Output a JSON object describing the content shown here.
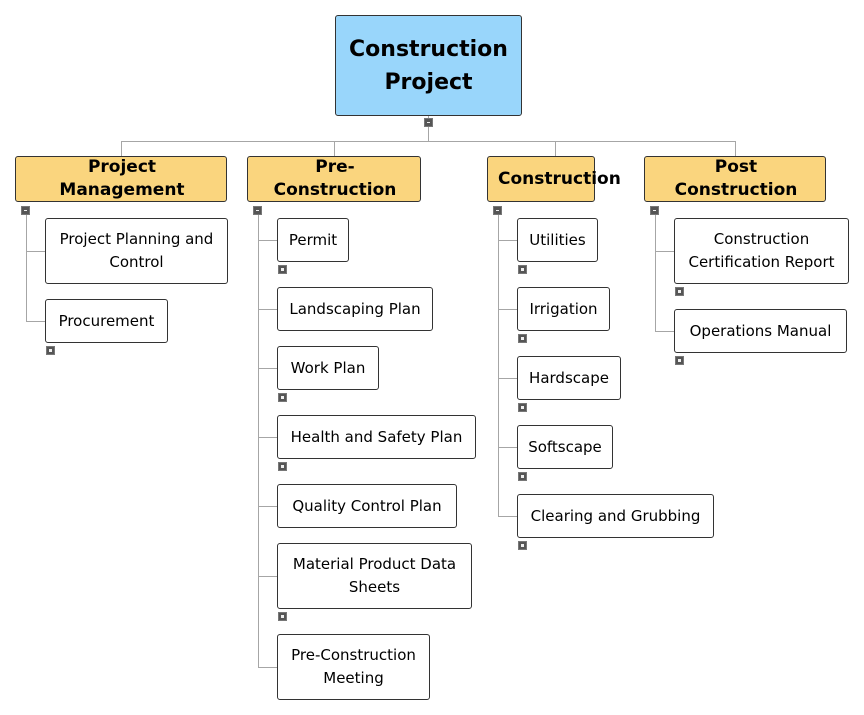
{
  "root": {
    "label": "Construction Project"
  },
  "colors": {
    "root_fill": "#99d6fb",
    "branch_fill": "#fad57e",
    "connector": "#a6a6a6"
  },
  "branches": [
    {
      "label": "Project Management",
      "children": [
        "Project Planning and Control",
        "Procurement"
      ]
    },
    {
      "label": "Pre-Construction",
      "children": [
        "Permit",
        "Landscaping Plan",
        "Work Plan",
        "Health and Safety Plan",
        "Quality Control Plan",
        "Material Product Data Sheets",
        "Pre-Construction Meeting"
      ]
    },
    {
      "label": "Construction",
      "children": [
        "Utilities",
        "Irrigation",
        "Hardscape",
        "Softscape",
        "Clearing and Grubbing"
      ]
    },
    {
      "label": "Post Construction",
      "children": [
        "Construction Certification Report",
        "Operations Manual"
      ]
    }
  ]
}
